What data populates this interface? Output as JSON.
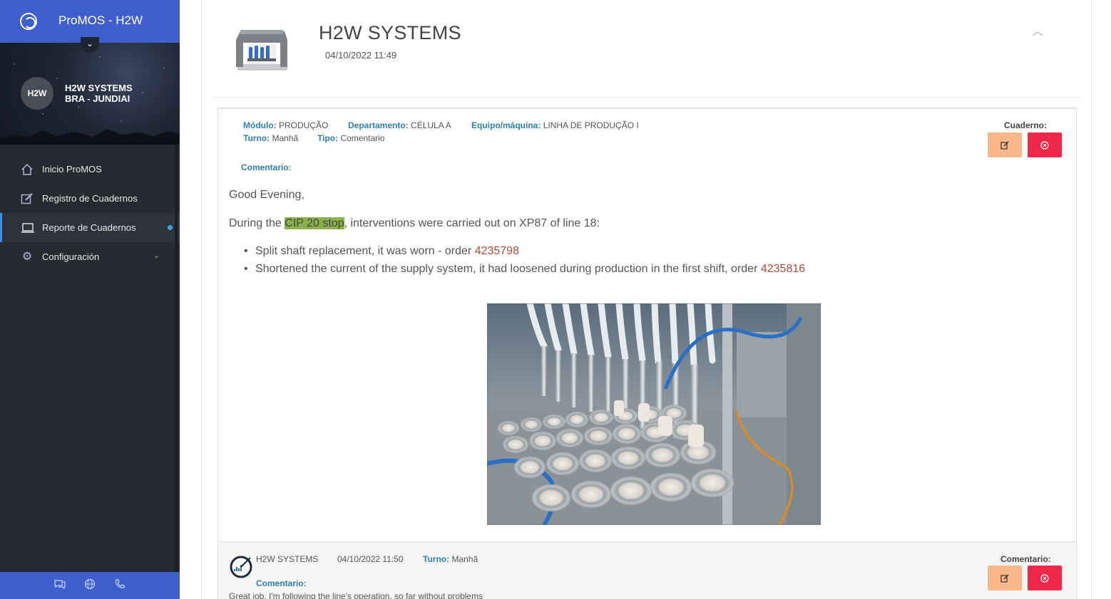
{
  "app": {
    "title": "ProMOS - H2W"
  },
  "profile": {
    "avatar_text": "H2W",
    "company_line1": "H2W SYSTEMS",
    "company_line2": "BRA - JUNDIAI"
  },
  "nav": {
    "items": [
      {
        "label": "Inicio ProMOS",
        "icon": "home-icon"
      },
      {
        "label": "Registro de Cuadernos",
        "icon": "edit-icon"
      },
      {
        "label": "Reporte de Cuadernos",
        "icon": "laptop-icon",
        "active": true
      },
      {
        "label": "Configuración",
        "icon": "gears-icon"
      }
    ]
  },
  "footer_icons": [
    "chat-icon",
    "globe-icon",
    "phone-icon"
  ],
  "header": {
    "title": "H2W SYSTEMS",
    "date": "04/10/2022 11:49",
    "collapse_icon": "chevron-up-icon"
  },
  "entry": {
    "fields": {
      "modulo_label": "Módulo:",
      "modulo_value": "PRODUÇÃO",
      "departamento_label": "Departamento:",
      "departamento_value": "CÉLULA A",
      "equipo_label": "Equipo/máquina:",
      "equipo_value": "LINHA DE PRODUÇÃO I",
      "turno_label": "Turno:",
      "turno_value": "Manhã",
      "tipo_label": "Tipo:",
      "tipo_value": "Comentario"
    },
    "cuaderno_label": "Cuaderno:",
    "comentario_label": "Comentario:",
    "greeting": "Good Evening,",
    "para_before": "During the ",
    "para_highlight": "CIP 20 stop",
    "para_after": ", interventions were carried out on XP87 of line 18:",
    "bullets": [
      {
        "text": "Split shaft replacement, it was worn - order ",
        "order": "4235798"
      },
      {
        "text": "Shortened the current of the supply system, it had loosened during production in the first shift, order ",
        "order": "4235816"
      }
    ],
    "colors": {
      "highlight": "#8ab24a",
      "order_link": "#b24a3a",
      "label_blue": "#2f7fb5",
      "edit_btn": "#f9b78a",
      "delete_btn": "#f02849"
    }
  },
  "reply": {
    "author": "H2W SYSTEMS",
    "date": "04/10/2022 11:50",
    "turno_label": "Turno:",
    "turno_value": "Manhã",
    "section_label": "Comentario:",
    "comment_label": "Comentario:",
    "text": "Great job, I'm following the line's operation, so far without problems"
  }
}
